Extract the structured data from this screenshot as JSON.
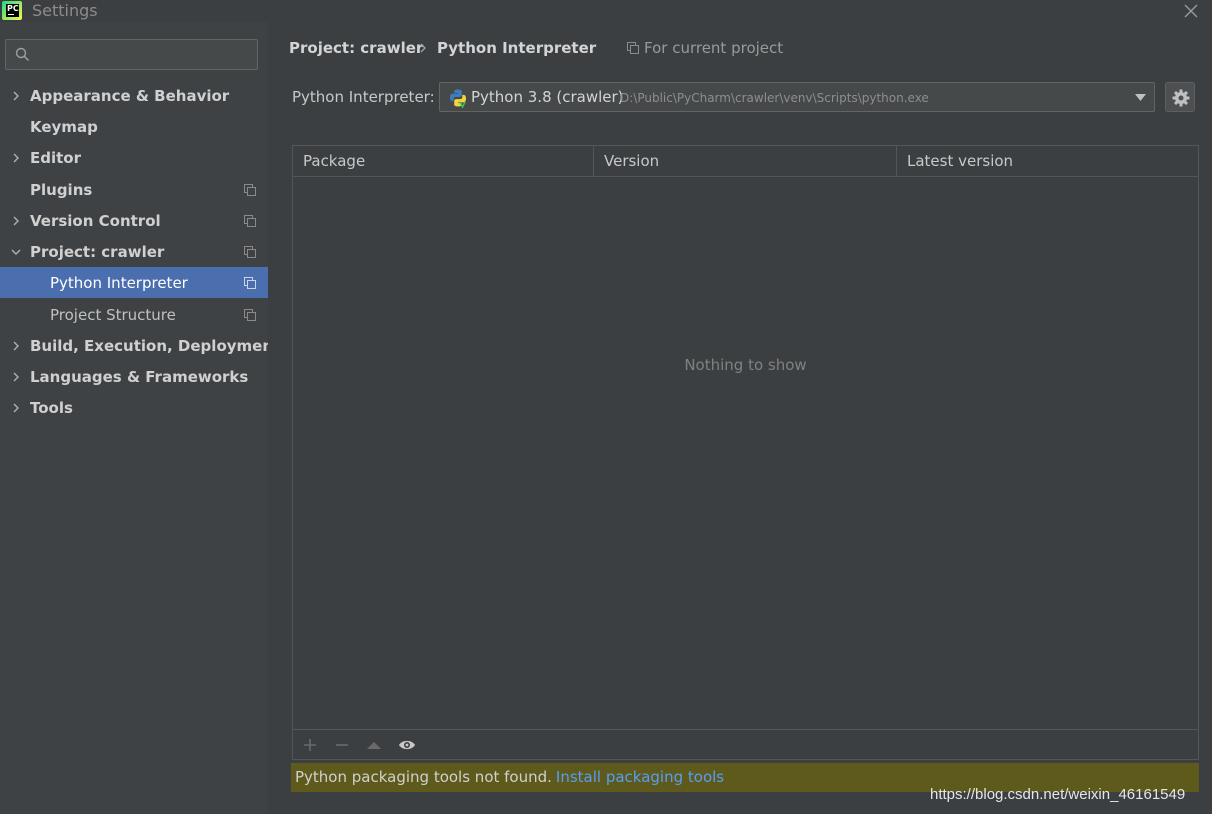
{
  "window": {
    "title": "Settings",
    "logo_text": "PC"
  },
  "sidebar": {
    "search": {
      "value": "",
      "placeholder": ""
    },
    "items": [
      {
        "label": "Appearance & Behavior",
        "expandable": true,
        "expanded": false,
        "project_scope": false
      },
      {
        "label": "Keymap",
        "expandable": false,
        "project_scope": false
      },
      {
        "label": "Editor",
        "expandable": true,
        "expanded": false,
        "project_scope": false
      },
      {
        "label": "Plugins",
        "expandable": false,
        "project_scope": true
      },
      {
        "label": "Version Control",
        "expandable": true,
        "expanded": false,
        "project_scope": true
      },
      {
        "label": "Project: crawler",
        "expandable": true,
        "expanded": true,
        "project_scope": true
      },
      {
        "label": "Python Interpreter",
        "child": true,
        "selected": true,
        "project_scope": true
      },
      {
        "label": "Project Structure",
        "child": true,
        "project_scope": true
      },
      {
        "label": "Build, Execution, Deployment",
        "expandable": true,
        "expanded": false,
        "project_scope": false
      },
      {
        "label": "Languages & Frameworks",
        "expandable": true,
        "expanded": false,
        "project_scope": false
      },
      {
        "label": "Tools",
        "expandable": true,
        "expanded": false,
        "project_scope": false
      }
    ]
  },
  "breadcrumb": {
    "parent": "Project: crawler",
    "current": "Python Interpreter",
    "scope_label": "For current project"
  },
  "interpreter": {
    "label": "Python Interpreter:",
    "selected_name": "Python 3.8 (crawler)",
    "selected_path": "D:\\Public\\PyCharm\\crawler\\venv\\Scripts\\python.exe"
  },
  "packages_table": {
    "columns": [
      "Package",
      "Version",
      "Latest version"
    ],
    "rows": [],
    "empty_text": "Nothing to show"
  },
  "toolbar": {
    "icons": [
      "add-icon",
      "remove-icon",
      "upgrade-icon",
      "eye-icon"
    ]
  },
  "warning": {
    "text": "Python packaging tools not found.",
    "link_text": "Install packaging tools"
  },
  "watermark": "https://blog.csdn.net/weixin_46161549",
  "colors": {
    "selection": "#4b6eaf",
    "link": "#589df6",
    "warning_bg": "#5d5a1c",
    "background": "#3c3f41"
  }
}
